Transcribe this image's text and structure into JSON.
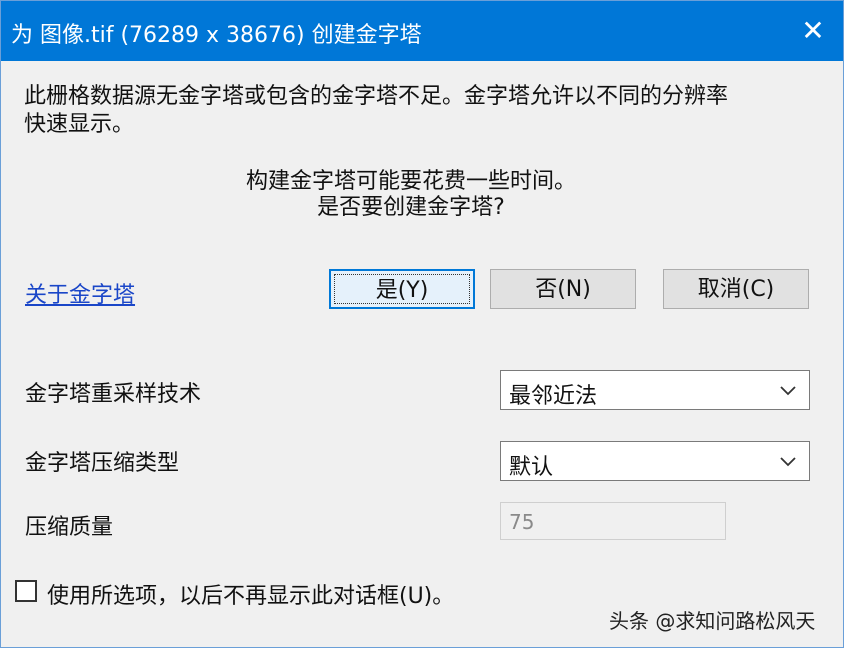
{
  "dialog": {
    "title": "为 图像.tif (76289 x 38676) 创建金字塔",
    "close_symbol": "✕",
    "message_line1": "此栅格数据源无金字塔或包含的金字塔不足。金字塔允许以不同的分辨率",
    "message_line2": "快速显示。",
    "prompt_line1": "构建金字塔可能要花费一些时间。",
    "prompt_line2": "是否要创建金字塔?",
    "about_link": "关于金字塔",
    "buttons": {
      "yes": "是(Y)",
      "no": "否(N)",
      "cancel": "取消(C)"
    },
    "resampling": {
      "label": "金字塔重采样技术",
      "selected": "最邻近法"
    },
    "compression": {
      "label": "金字塔压缩类型",
      "selected": "默认"
    },
    "quality": {
      "label": "压缩质量",
      "value": "75"
    },
    "remember": {
      "label": "使用所选项，以后不再显示此对话框(U)。",
      "checked": false
    },
    "watermark": "头条 @求知问路松风天"
  },
  "colors": {
    "titlebar": "#0077d7",
    "link": "#1a46c8",
    "default_button_border": "#0078d7"
  }
}
